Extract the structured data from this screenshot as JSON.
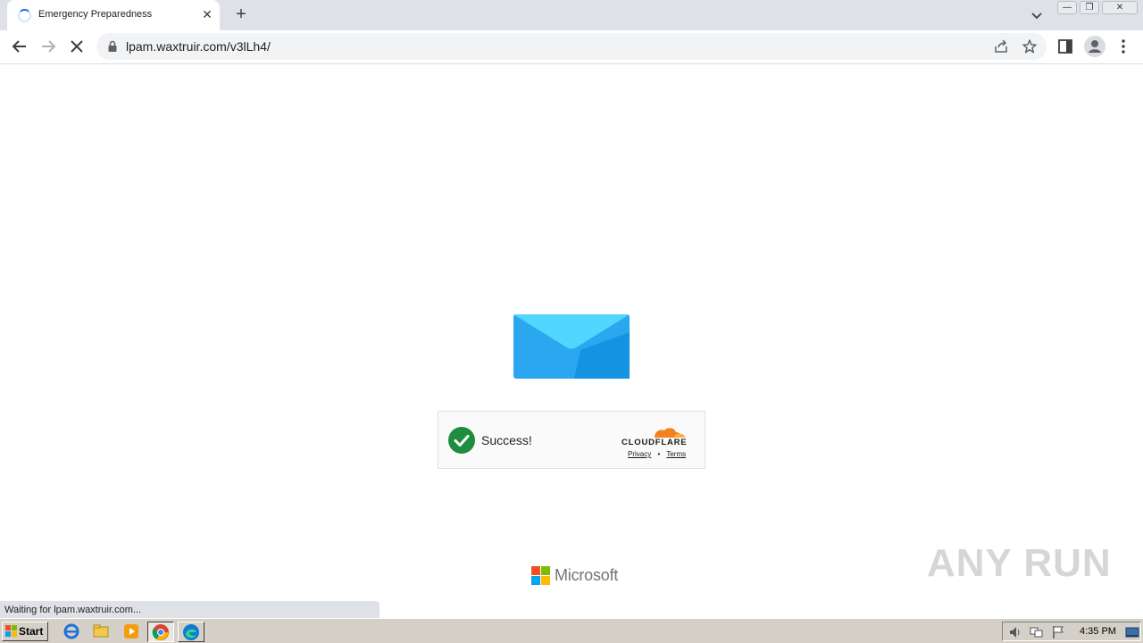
{
  "browser": {
    "tab": {
      "title": "Emergency Preparedness",
      "close": "✕"
    },
    "new_tab": "+",
    "url": "lpam.waxtruir.com/v3lLh4/",
    "window_controls": {
      "minimize": "—",
      "restore": "❐",
      "close": "✕"
    }
  },
  "page": {
    "captcha": {
      "status": "Success!",
      "brand": "CLOUDFLARE",
      "privacy": "Privacy",
      "separator": "•",
      "terms": "Terms"
    },
    "footer_brand": "Microsoft",
    "watermark": "ANY RUN",
    "status_bar": "Waiting for lpam.waxtruir.com..."
  },
  "taskbar": {
    "start_label": "Start",
    "clock": "4:35 PM",
    "pinned_icons": [
      "ie-icon",
      "explorer-icon",
      "media-player-icon",
      "chrome-icon",
      "edge-icon"
    ]
  },
  "colors": {
    "envelope_body": "#2AA7EF",
    "envelope_flap": "#50D6FF",
    "success_green": "#1E8E3E",
    "cloudflare_orange": "#F48120"
  }
}
